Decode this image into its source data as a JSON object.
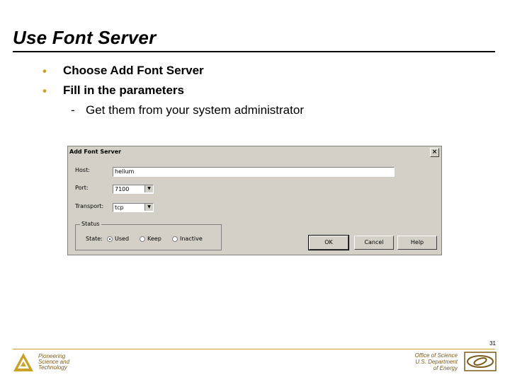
{
  "slide": {
    "title": "Use Font Server",
    "bullets": [
      "Choose Add Font Server",
      "Fill in the parameters"
    ],
    "sub_bullet_dash": "-",
    "sub_bullet": "Get them from your system administrator",
    "bullet_glyph": "•",
    "page_number": "31"
  },
  "dialog": {
    "title": "Add Font Server",
    "close_glyph": "×",
    "host_label": "Host:",
    "host_value": "helium",
    "port_label": "Port:",
    "port_value": "7100",
    "transport_label": "Transport:",
    "transport_value": "tcp",
    "status_label": "Status",
    "state_label": "State:",
    "radio_used": "Used",
    "radio_keep": "Keep",
    "radio_inactive": "Inactive",
    "ok_label": "OK",
    "cancel_label": "Cancel",
    "help_label": "Help",
    "combo_arrow": "▼"
  },
  "footer": {
    "left_line1": "Pioneering",
    "left_line2": "Science and",
    "left_line3": "Technology",
    "right_line1": "Office of Science",
    "right_line2": "U.S. Department",
    "right_line3": "of Energy"
  },
  "colors": {
    "accent": "#c9a227",
    "dialog_bg": "#d4d0c8",
    "footer_text": "#7a5c1c"
  }
}
